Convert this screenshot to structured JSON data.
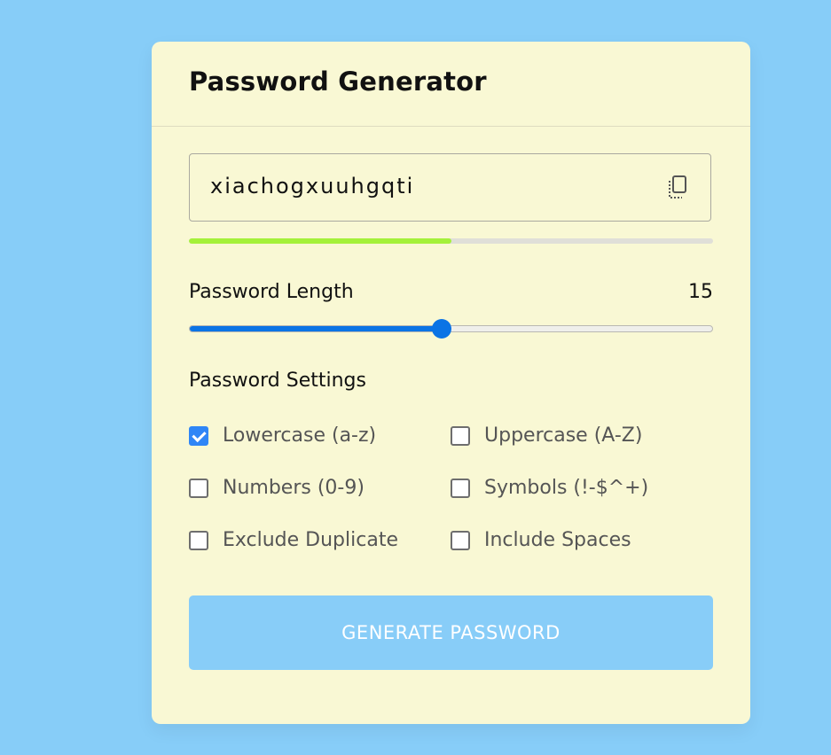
{
  "app": {
    "title": "Password Generator"
  },
  "password": {
    "value": "xiachogxuuhgqti",
    "strength_fraction": 0.5
  },
  "length": {
    "label": "Password Length",
    "value": 15,
    "min": 1,
    "max": 30
  },
  "settings": {
    "label": "Password Settings",
    "options": [
      {
        "label": "Lowercase (a-z)",
        "checked": true
      },
      {
        "label": "Uppercase (A-Z)",
        "checked": false
      },
      {
        "label": "Numbers (0-9)",
        "checked": false
      },
      {
        "label": "Symbols (!-$^+)",
        "checked": false
      },
      {
        "label": "Exclude Duplicate",
        "checked": false
      },
      {
        "label": "Include Spaces",
        "checked": false
      }
    ]
  },
  "actions": {
    "generate_label": "GENERATE PASSWORD"
  },
  "icons": {
    "copy": "copy-icon"
  },
  "colors": {
    "background": "#87cdf8",
    "card": "#f9f8d4",
    "accent": "#0b74e5",
    "strength": "#a4f13a",
    "button": "#88cdf8"
  }
}
